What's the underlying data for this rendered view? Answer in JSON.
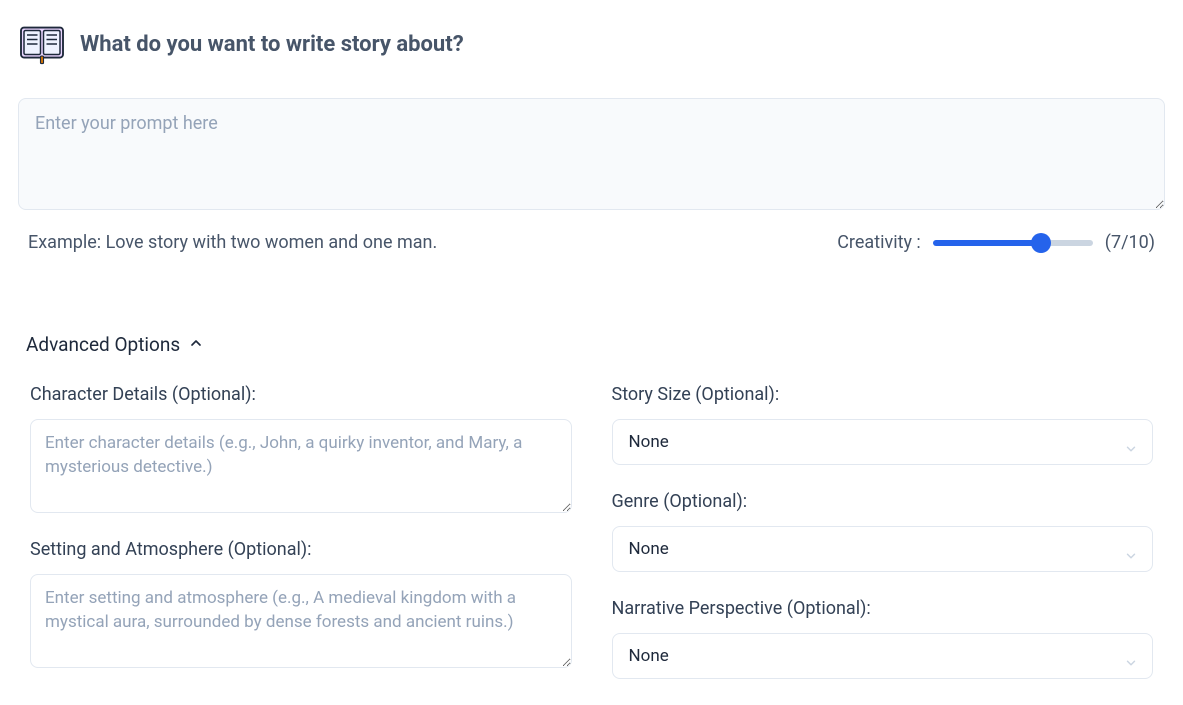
{
  "header": {
    "title": "What do you want to write story about?"
  },
  "prompt": {
    "placeholder": "Enter your prompt here",
    "value": ""
  },
  "example": "Example: Love story with two women and one man.",
  "creativity": {
    "label": "Creativity :",
    "value": 7,
    "max": 10,
    "display": "(7/10)"
  },
  "advanced": {
    "toggle_label": "Advanced Options",
    "character": {
      "label": "Character Details (Optional):",
      "placeholder": "Enter character details (e.g., John, a quirky inventor, and Mary, a mysterious detective.)"
    },
    "setting": {
      "label": "Setting and Atmosphere (Optional):",
      "placeholder": "Enter setting and atmosphere (e.g., A medieval kingdom with a mystical aura, surrounded by dense forests and ancient ruins.)"
    },
    "story_size": {
      "label": "Story Size (Optional):",
      "selected": "None"
    },
    "genre": {
      "label": "Genre (Optional):",
      "selected": "None"
    },
    "narrative": {
      "label": "Narrative Perspective (Optional):",
      "selected": "None"
    }
  },
  "colors": {
    "accent": "#2563eb"
  }
}
